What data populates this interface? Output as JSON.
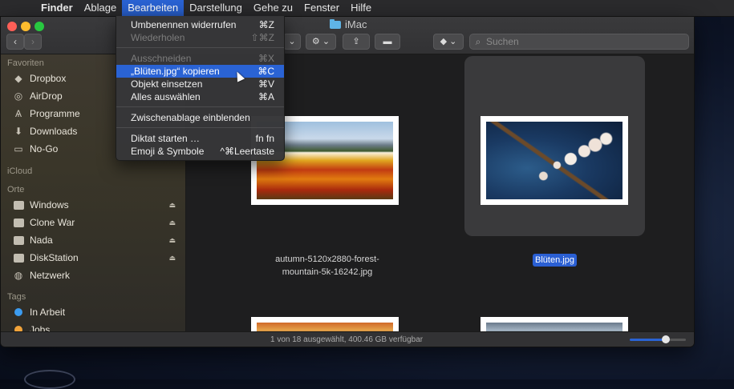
{
  "menubar": {
    "items": [
      {
        "label": "Finder",
        "bold": true
      },
      {
        "label": "Ablage"
      },
      {
        "label": "Bearbeiten",
        "active": true
      },
      {
        "label": "Darstellung"
      },
      {
        "label": "Gehe zu"
      },
      {
        "label": "Fenster"
      },
      {
        "label": "Hilfe"
      }
    ]
  },
  "window": {
    "title": "iMac",
    "search_placeholder": "Suchen"
  },
  "sidebar": {
    "favoriten_header": "Favoriten",
    "favoriten": [
      "Dropbox",
      "AirDrop",
      "Programme",
      "Downloads",
      "No-Go"
    ],
    "icloud_header": "iCloud",
    "orte_header": "Orte",
    "orte": [
      "Windows",
      "Clone War",
      "Nada",
      "DiskStation",
      "Netzwerk"
    ],
    "tags_header": "Tags",
    "tags": [
      {
        "label": "In Arbeit",
        "color": "#3c9cf0"
      },
      {
        "label": "Jobs",
        "color": "#f2a33a"
      }
    ]
  },
  "files": [
    {
      "name_line1": "autumn-5120x2880-forest-",
      "name_line2": "mountain-5k-16242.jpg"
    },
    {
      "name": "Blüten.jpg",
      "selected": true
    }
  ],
  "status": {
    "text": "1 von 18 ausgewählt, 400.46 GB verfügbar",
    "zoom": 0.7
  },
  "edit_menu": {
    "items": [
      {
        "label": "Umbenennen widerrufen",
        "shortcut": "⌘Z"
      },
      {
        "label": "Wiederholen",
        "shortcut": "⇧⌘Z",
        "disabled": true
      },
      {
        "label": "Ausschneiden",
        "shortcut": "⌘X",
        "disabled": true
      },
      {
        "label": "„Blüten.jpg“ kopieren",
        "shortcut": "⌘C",
        "highlighted": true
      },
      {
        "label": "Objekt einsetzen",
        "shortcut": "⌘V"
      },
      {
        "label": "Alles auswählen",
        "shortcut": "⌘A"
      },
      {
        "label": "Zwischenablage einblenden",
        "shortcut": ""
      },
      {
        "label": "Diktat starten …",
        "shortcut": "fn fn"
      },
      {
        "label": "Emoji & Symbole",
        "shortcut": "^⌘Leertaste"
      }
    ]
  },
  "colors": {
    "accent": "#2a63d4",
    "sidebar_bg": "#3a3629",
    "content_bg": "#1e1e1f"
  }
}
